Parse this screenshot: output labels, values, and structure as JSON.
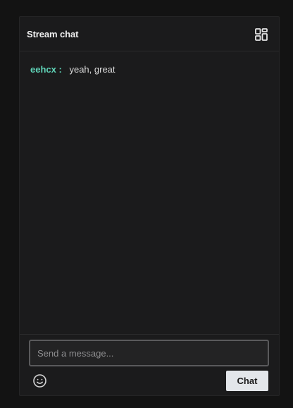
{
  "header": {
    "title": "Stream chat",
    "layout_icon": "layout-grid-icon"
  },
  "messages": [
    {
      "user": "eehcx",
      "separator": ":",
      "text": "yeah, great"
    }
  ],
  "composer": {
    "placeholder": "Send a message...",
    "value": "",
    "emoji_icon": "smiley-icon",
    "send_label": "Chat"
  },
  "colors": {
    "background": "#131313",
    "panel": "#1b1b1c",
    "username": "#5fd3b7",
    "button": "#e3e6ea"
  }
}
